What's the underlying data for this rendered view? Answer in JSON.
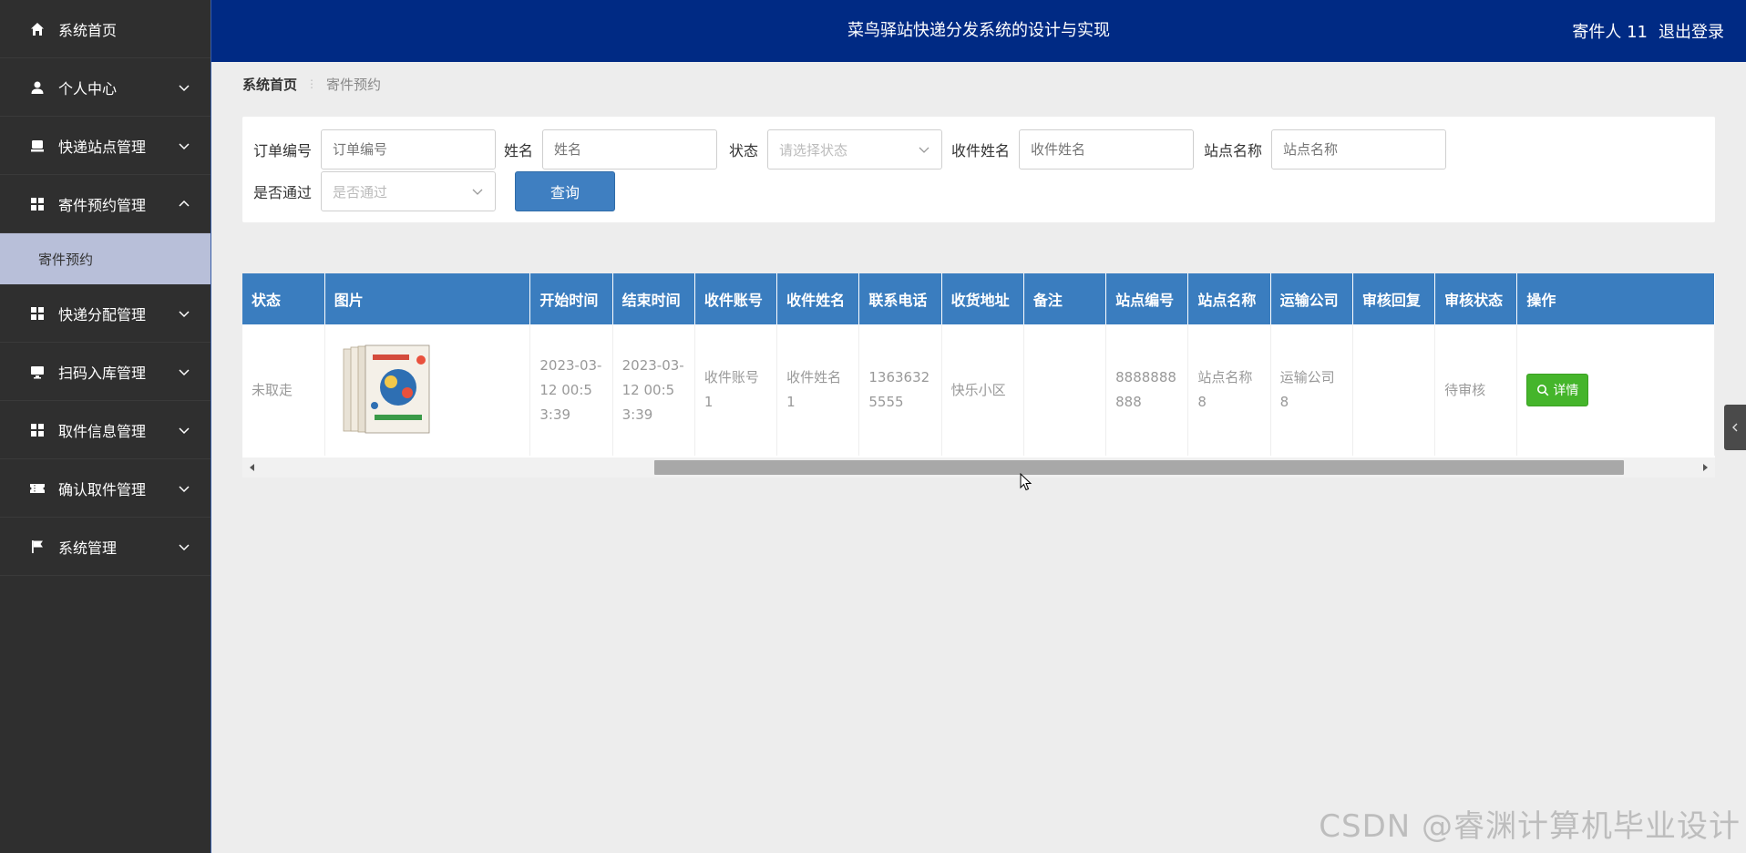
{
  "app": {
    "title": "菜鸟驿站快递分发系统的设计与实现",
    "user_label": "寄件人 11",
    "logout_label": "退出登录"
  },
  "sidebar": {
    "items": [
      {
        "label": "系统首页",
        "icon": "home-icon"
      },
      {
        "label": "个人中心",
        "icon": "user-icon"
      },
      {
        "label": "快递站点管理",
        "icon": "inbox-icon"
      },
      {
        "label": "寄件预约管理",
        "icon": "grid-icon",
        "expanded": true
      },
      {
        "label": "快递分配管理",
        "icon": "grid-icon"
      },
      {
        "label": "扫码入库管理",
        "icon": "monitor-icon"
      },
      {
        "label": "取件信息管理",
        "icon": "grid-icon"
      },
      {
        "label": "确认取件管理",
        "icon": "ticket-icon"
      },
      {
        "label": "系统管理",
        "icon": "flag-icon"
      }
    ],
    "submenu": {
      "label": "寄件预约"
    }
  },
  "breadcrumb": {
    "home": "系统首页",
    "current": "寄件预约"
  },
  "search": {
    "order_no_label": "订单编号",
    "order_no_placeholder": "订单编号",
    "name_label": "姓名",
    "name_placeholder": "姓名",
    "status_label": "状态",
    "status_placeholder": "请选择状态",
    "receiver_label": "收件姓名",
    "receiver_placeholder": "收件姓名",
    "station_label": "站点名称",
    "station_placeholder": "站点名称",
    "passed_label": "是否通过",
    "passed_placeholder": "是否通过",
    "query_label": "查询"
  },
  "table": {
    "headers": [
      "状态",
      "图片",
      "开始时间",
      "结束时间",
      "收件账号",
      "收件姓名",
      "联系电话",
      "收货地址",
      "备注",
      "站点编号",
      "站点名称",
      "运输公司",
      "审核回复",
      "审核状态",
      "操作"
    ],
    "rows": [
      {
        "status": "未取走",
        "start_time": "2023-03-12 00:53:39",
        "end_time": "2023-03-12 00:53:39",
        "receiver_account": "收件账号1",
        "receiver_name": "收件姓名1",
        "phone": "13636325555",
        "address": "快乐小区",
        "remark": "",
        "station_no": "8888888888",
        "station_name": "站点名称8",
        "company": "运输公司8",
        "review_reply": "",
        "review_status": "待审核",
        "action_label": "详情"
      }
    ]
  },
  "watermark": "CSDN @睿渊计算机毕业设计",
  "colors": {
    "sidebar_bg": "#2f2f2f",
    "header_bg": "#002a84",
    "table_header_bg": "#3a7dbf",
    "query_button": "#3f7fc1",
    "detail_button": "#45b52b",
    "submenu_active": "#b8bfd9"
  }
}
